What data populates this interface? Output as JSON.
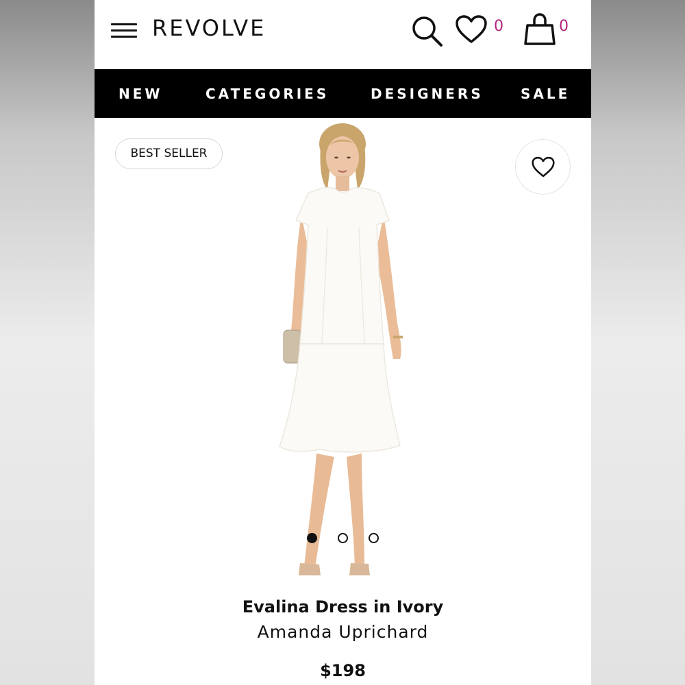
{
  "header": {
    "logo": "REVOLVE",
    "wishlist_count": "0",
    "bag_count": "0",
    "count_color": "#b0247a"
  },
  "nav": {
    "items": [
      "NEW",
      "CATEGORIES",
      "DESIGNERS",
      "SALE"
    ]
  },
  "product": {
    "badge": "BEST SELLER",
    "name": "Evalina Dress in Ivory",
    "designer": "Amanda Uprichard",
    "price": "$198",
    "image_carousel": {
      "total": 3,
      "active": 1
    }
  },
  "icons": {
    "menu": "hamburger-menu-icon",
    "search": "search-icon",
    "wishlist": "heart-icon",
    "bag": "shopping-bag-icon",
    "favorite": "heart-icon"
  }
}
